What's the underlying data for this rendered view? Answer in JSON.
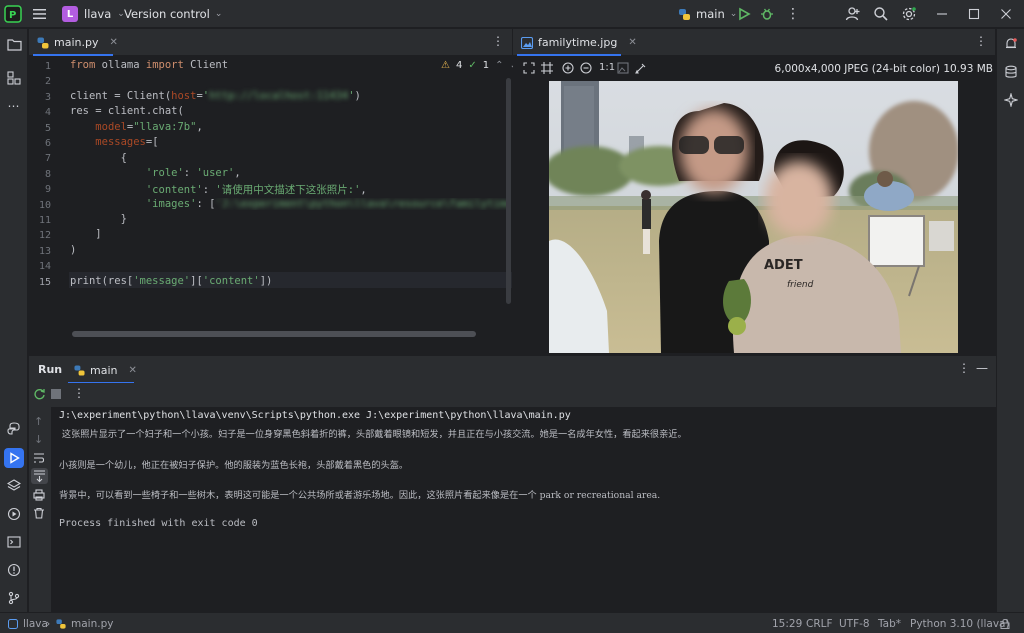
{
  "titlebar": {
    "project_badge": "L",
    "project_name": "llava",
    "vcs_label": "Version control",
    "run_config": "main"
  },
  "editor": {
    "tab_label": "main.py",
    "inspection_warnings": "4",
    "inspection_ok": "1",
    "line_numbers": [
      "1",
      "2",
      "3",
      "4",
      "5",
      "6",
      "7",
      "8",
      "9",
      "10",
      "11",
      "12",
      "13",
      "14",
      "15"
    ],
    "code": {
      "l1_from": "from",
      "l1_mod": " ollama ",
      "l1_import": "import",
      "l1_name": " Client",
      "l3_a": "client = Client(",
      "l3_param": "host",
      "l3_eq": "=",
      "l3_q1": "'",
      "l3_host": "http://localhost:11434",
      "l3_q2": "'",
      "l3_b": ")",
      "l4": "res = client.chat(",
      "l5_param": "model",
      "l5_rest": "=",
      "l5_val": "\"llava:7b\"",
      "l5_comma": ",",
      "l6_param": "messages",
      "l6_rest": "=[",
      "l7": "{",
      "l8_key": "'role'",
      "l8_sep": ": ",
      "l8_val": "'user'",
      "l8_comma": ",",
      "l9_key": "'content'",
      "l9_sep": ": ",
      "l9_val": "'请使用中文描述下这张照片:'",
      "l9_comma": ",",
      "l10_key": "'images'",
      "l10_sep": ": [",
      "l10_val": "'J:\\experiment\\python\\llava\\resource\\familytime.jpg'",
      "l10_end": "]",
      "l11": "}",
      "l12": "]",
      "l13": ")",
      "l15_a": "print(res[",
      "l15_k1": "'message'",
      "l15_b": "][",
      "l15_k2": "'content'",
      "l15_c": "])"
    }
  },
  "viewer": {
    "tab_label": "familytime.jpg",
    "zoom_actual": "1:1",
    "image_info": "6,000x4,000 JPEG (24-bit color) 10.93 MB"
  },
  "run": {
    "panel_title": "Run",
    "tab_label": "main",
    "output": [
      "J:\\experiment\\python\\llava\\venv\\Scripts\\python.exe J:\\experiment\\python\\llava\\main.py",
      " 这张照片显示了一个妇子和一个小孩。妇子是一位身穿黑色斜着折的裤，头部戴着眼镜和短发，并且正在与小孩交流。她是一名成年女性，看起来很亲近。",
      "",
      "小孩则是一个幼儿，他正在被妇子保护。他的服装为蓝色长袍，头部戴着黑色的头盔。",
      "",
      "背景中，可以看到一些椅子和一些树木，表明这可能是一个公共场所或者游乐场地。因此，这张照片看起来像是在一个 park or recreational area.",
      "",
      "Process finished with exit code 0"
    ]
  },
  "statusbar": {
    "project": "llava",
    "file": "main.py",
    "position": "15:29",
    "line_sep": "CRLF",
    "encoding": "UTF-8",
    "indent": "Tab*",
    "interpreter": "Python 3.10 (llava)"
  },
  "colors": {
    "accent": "#3574f0",
    "keyword": "#cf8e6d",
    "string": "#6aab73",
    "param": "#aa4926",
    "run_green": "#5fb865"
  }
}
